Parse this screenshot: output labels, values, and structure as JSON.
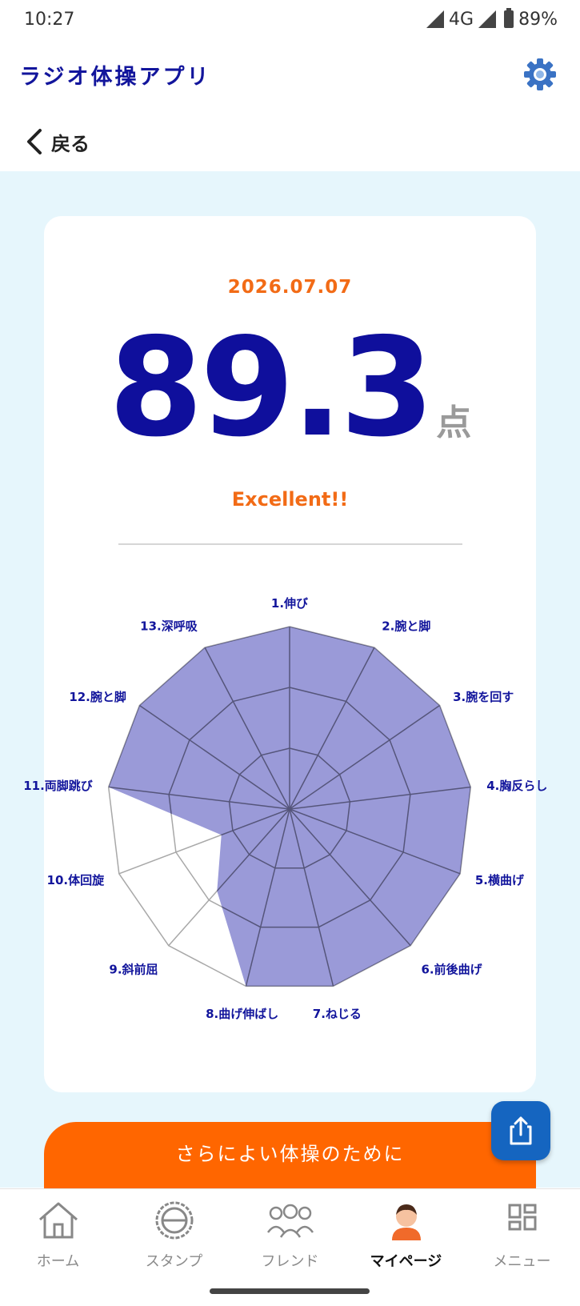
{
  "status_bar": {
    "time": "10:27",
    "network": "4G",
    "battery": "89%"
  },
  "header": {
    "title": "ラジオ体操アプリ",
    "settings_icon": "gear-icon"
  },
  "back": {
    "label": "戻る",
    "icon": "chevron-left-icon"
  },
  "result": {
    "date": "2026.07.07",
    "score": "89.3",
    "unit": "点",
    "rank": "Excellent!!"
  },
  "radar": {
    "axes": [
      {
        "label": "1.伸び",
        "value": 1.0
      },
      {
        "label": "2.腕と脚",
        "value": 1.0
      },
      {
        "label": "3.腕を回す",
        "value": 1.0
      },
      {
        "label": "4.胸反らし",
        "value": 1.0
      },
      {
        "label": "5.横曲げ",
        "value": 1.0
      },
      {
        "label": "6.前後曲げ",
        "value": 1.0
      },
      {
        "label": "7.ねじる",
        "value": 1.0
      },
      {
        "label": "8.曲げ伸ばし",
        "value": 1.0
      },
      {
        "label": "9.斜前屈",
        "value": 0.6
      },
      {
        "label": "10.体回旋",
        "value": 0.4
      },
      {
        "label": "11.両脚跳び",
        "value": 1.0
      },
      {
        "label": "12.腕と脚",
        "value": 1.0
      },
      {
        "label": "13.深呼吸",
        "value": 1.0
      }
    ],
    "max": 1.0,
    "rings": 3,
    "fill_color": "#9a9ad8",
    "line_color": "#55557a",
    "label_color": "#12159c"
  },
  "cta": {
    "label": "さらによい体操のために"
  },
  "share": {
    "icon": "share-icon"
  },
  "nav": {
    "items": [
      {
        "label": "ホーム",
        "icon": "home-icon",
        "active": false
      },
      {
        "label": "スタンプ",
        "icon": "stamp-icon",
        "active": false
      },
      {
        "label": "フレンド",
        "icon": "friends-icon",
        "active": false
      },
      {
        "label": "マイページ",
        "icon": "avatar-icon",
        "active": true
      },
      {
        "label": "メニュー",
        "icon": "menu-grid-icon",
        "active": false
      }
    ]
  },
  "colors": {
    "brand": "#12159c",
    "accent": "#ff6600",
    "background": "#e6f6fc",
    "share": "#1565c0"
  }
}
